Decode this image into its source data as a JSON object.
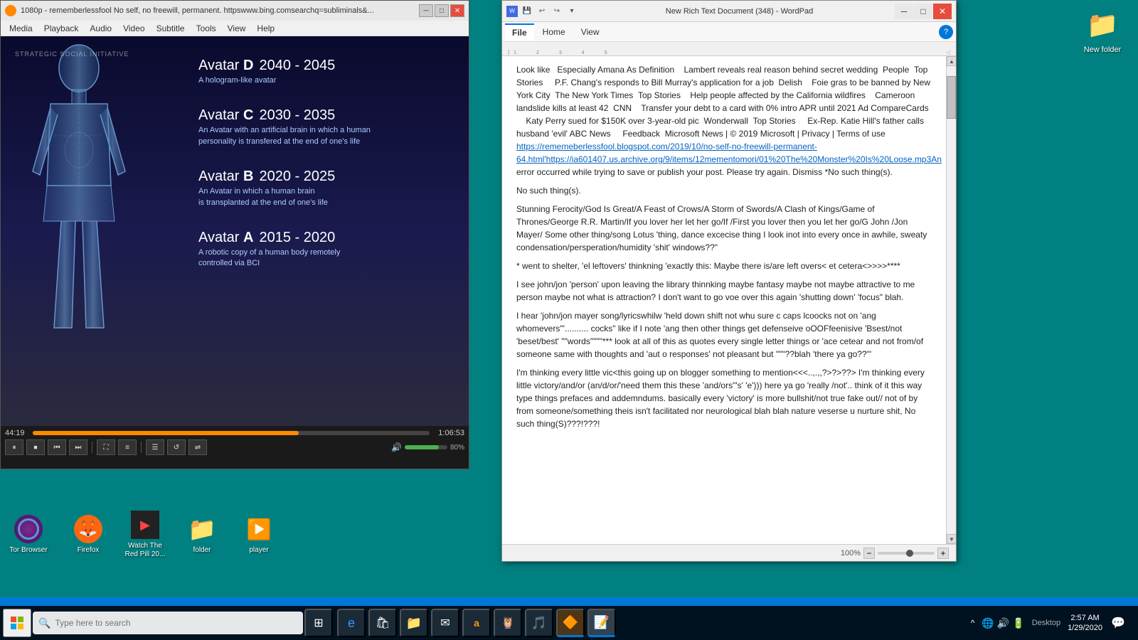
{
  "desktop": {
    "background_color": "#008080"
  },
  "vlc_window": {
    "title": "1080p - rememberlessfool No self, no freewill, permanent. httpswww.bing.comsearchq=subliminals&...",
    "watermark": "STRATEGIC SOCIAL INITIATIVE",
    "menu_items": [
      "Media",
      "Playback",
      "Audio",
      "Video",
      "Subtitle",
      "Tools",
      "View",
      "Help"
    ],
    "time_elapsed": "44:19",
    "time_total": "1:06:53",
    "volume_pct": "80%",
    "progress_pct": 67,
    "volume_pct_num": 80,
    "avatar_entries": [
      {
        "label": "Avatar D",
        "letter": "D",
        "years": "2040 - 2045",
        "desc": "A hologram-like avatar"
      },
      {
        "label": "Avatar C",
        "letter": "C",
        "years": "2030 - 2035",
        "desc": "An Avatar with an artificial brain in which a human personality  is transfered at the end of one's life"
      },
      {
        "label": "Avatar B",
        "letter": "B",
        "years": "2020 - 2025",
        "desc": "An Avatar in which a human brain\nis transplanted at the end of one's life"
      },
      {
        "label": "Avatar A",
        "letter": "A",
        "years": "2015 - 2020",
        "desc": "A robotic copy of a human body remotely\ncontrolled via BCI"
      }
    ]
  },
  "wordpad_window": {
    "title": "New Rich Text Document (348) - WordPad",
    "ribbon_tabs": [
      "File",
      "Home",
      "View"
    ],
    "active_tab": "File",
    "zoom_pct": "100%",
    "content_paragraphs": [
      "Look like   Especially Amana As Definition    Lambert reveals real reason behind secret wedding  People  Top Stories    P.F. Chang's responds to Bill Murray's application for a job  Delish   Foie gras to be banned by New York City  The New York Times  Top Stories   Help people affected by the California wildfires   Cameroon landslide kills at least 42  CNN   Transfer your debt to a card with 0% intro APR until 2021 Ad CompareCards    Katy Perry sued for $150K over 3-year-old pic  Wonderwall  Top Stories    Ex-Rep. Katie Hill's father calls husband 'evil' ABC News    Feedback  Microsoft News | © 2019 Microsoft | Privacy | Terms of use",
      "https://rememberlessfool.blogspot.com/2019/10/no-self-no-freewill-permanent-64.html'https://ia601407.us.archive.org/9/items/12mementomori/01%20The%20Monster%20Is%20Loose.mp3An error occurred while trying to save or publish your post. Please try again. Dismiss *No such thing(s).",
      "No such thing(s).",
      "Stunning Ferocity/God Is Great/A Feast of Crows/A Storm of Swords/A Clash of Kings/Game of Thrones/George R.R. Martin/If you lover her let her go/If /First you lover then you let her go/G John /Jon Mayer/ Some other thing/song Lotus 'thing, dance excecise thing I look inot into every once in awhile, sweaty condensation/persperation/humidity 'shit' windows??\"",
      "* went to shelter,  'el leftovers' thinkning 'exactly this: Maybe there is/are left overs< et cetera<>>>>****",
      "I see john/jon 'person' upon leaving the library thinnking maybe fantasy maybe not maybe attractive to me person maybe not what is attraction? I don't want to go voe over this again 'shutting down' 'focus\" blah.",
      "I hear 'john/jon mayer song/lyricswhilw 'held down shift not whu sure c caps lcoocks not on 'ang whomevers'\".......... cocks\" like if I note 'ang then other things get defenseive oOOFfeenisive 'Bsest/not 'beset/best' \"\"words\"\"\"\"*** look at all of this as quotes every single letter things or 'ace cetear and not from/of someone same with thoughts and 'aut o responses' not pleasant but \"\"\"??blah 'there ya go??'\"",
      "I'm thinking every little vic<this going up on blogger something to mention<<<..,.,,?>?>??> I'm thinking every little victory/and/or (an/d/or/'need them this these 'and/ors\"'s' 'e'))) here ya go 'really /not'.. think of it this way type things prefaces and addemndums. basically every 'victory' is more bullshit/not true fake out// not of by from someone/something theis isn't facilitated nor neurological blah blah nature veserse u nurture shit, No such thing(S)???!???!"
    ],
    "link_text": "https://rememberlessfool.blogspot.com/2019/10/no-self-no-freewill-permanent-64.html'https://ia601407.us.archive.org/9/items/12mementomori/01%20The%20Monster%20Is%20Loose.mp3An"
  },
  "desktop_icons": [
    {
      "id": "folder",
      "label": "folder",
      "type": "folder"
    },
    {
      "id": "firefox",
      "label": "Firefox",
      "type": "firefox"
    },
    {
      "id": "video",
      "label": "Watch The\nRed Pill 20...",
      "type": "video"
    },
    {
      "id": "tor",
      "label": "Tor Browser",
      "type": "tor"
    }
  ],
  "new_folder": {
    "label": "New folder"
  },
  "taskbar": {
    "search_placeholder": "Type here to search",
    "clock_time": "2:57 AM",
    "clock_date": "1/29/2020",
    "desktop_label": "Desktop"
  }
}
